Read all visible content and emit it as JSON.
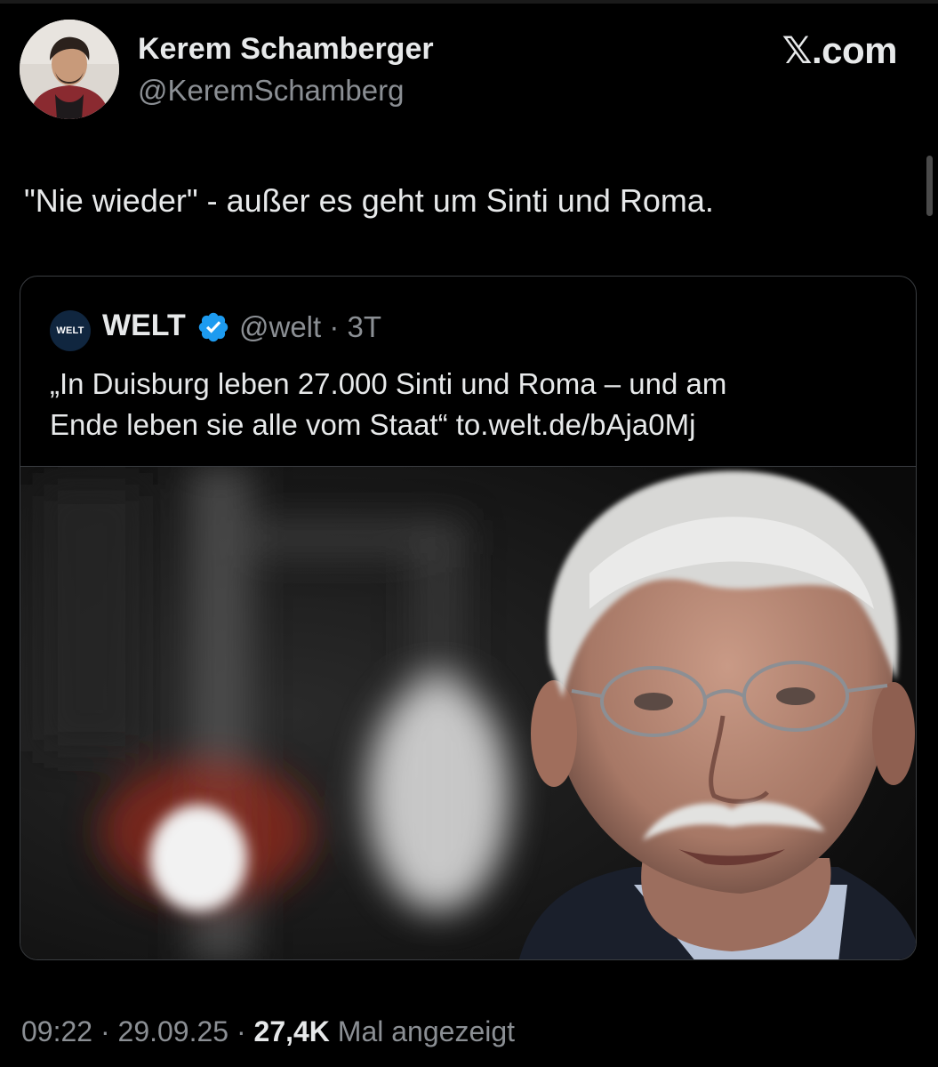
{
  "header": {
    "display_name": "Kerem Schamberger",
    "handle": "@KeremSchamberg",
    "site_label": "𝕏.com"
  },
  "tweet": {
    "text": "\"Nie wieder\" - außer es geht um Sinti und Roma."
  },
  "quoted_tweet": {
    "logo_text": "WELT",
    "name": "WELT",
    "verified": true,
    "handle_time": "@welt · 3T",
    "text_line1": "„In Duisburg leben 27.000 Sinti und Roma – und am",
    "text_line2": "Ende leben sie alle vom Staat“ to.welt.de/bAja0Mj"
  },
  "footer": {
    "time_date": "09:22 · 29.09.25 · ",
    "views_count": "27,4K",
    "views_label": " Mal angezeigt"
  },
  "colors": {
    "background": "#000000",
    "text_primary": "#e7e9ea",
    "text_secondary": "#8b8f94",
    "verified_blue": "#1d9bf0",
    "welt_logo_bg": "#10263f"
  }
}
